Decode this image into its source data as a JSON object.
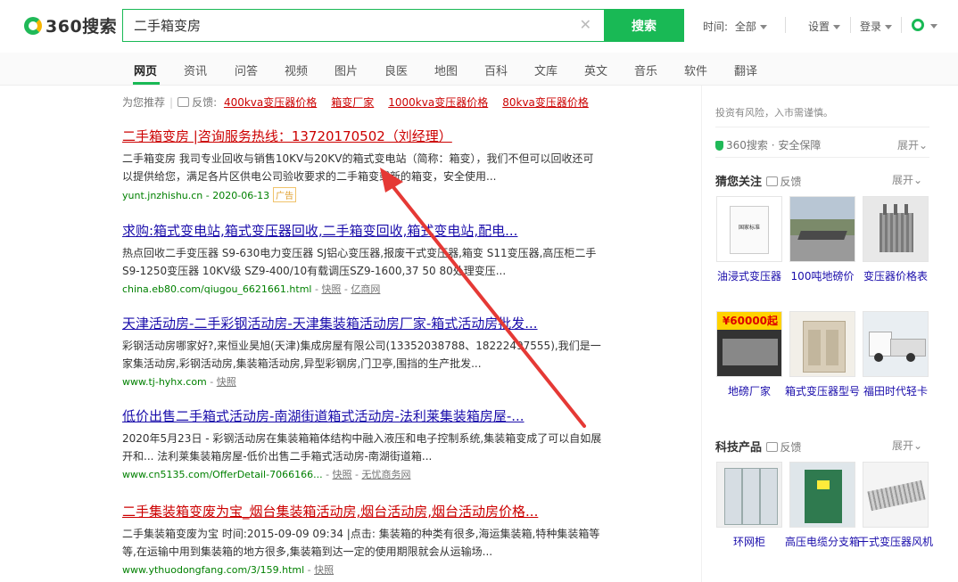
{
  "header": {
    "logo_text": "360搜索",
    "search_value": "二手箱变房",
    "search_button": "搜索",
    "time_label": "时间:",
    "time_value": "全部",
    "settings_label": "设置",
    "login_label": "登录"
  },
  "tabs": [
    "网页",
    "资讯",
    "问答",
    "视频",
    "图片",
    "良医",
    "地图",
    "百科",
    "文库",
    "英文",
    "音乐",
    "软件",
    "翻译"
  ],
  "suggestions": {
    "label": "为您推荐",
    "feedback": "反馈",
    "items": [
      "400kva变压器价格",
      "箱变厂家",
      "1000kva变压器价格",
      "80kva变压器价格"
    ]
  },
  "results": [
    {
      "title": "二手箱变房 |咨询服务热线：13720170502（刘经理）",
      "desc": "二手箱变房 我司专业回收与销售10KV与20KV的箱式变电站（简称：箱变），我们不但可以回收还可以提供给您，满足各片区供电公司验收要求的二手箱变或新的箱变，安全使用...",
      "url": "yunt.jnzhishu.cn - 2020-06-13",
      "ad": "广告"
    },
    {
      "title": "求购:箱式变电站,箱式变压器回收,二手箱变回收,箱式变电站,配电...",
      "desc": "热点回收二手变压器 S9-630电力变压器 SJ铝心变压器,报废干式变压器,箱变 S11变压器,高压柜二手S9-1250变压器 10KV级 SZ9-400/10有载调压SZ9-1600,37 50 80处理变压...",
      "url": "china.eb80.com/qiugou_6621661.html",
      "snap": "快照",
      "source": "亿商网"
    },
    {
      "title": "天津活动房-二手彩钢活动房-天津集装箱活动房厂家-箱式活动房批发...",
      "desc": "彩钢活动房哪家好?,来恒业昊旭(天津)集成房屋有限公司(13352038788、18222497555),我们是一家集活动房,彩钢活动房,集装箱活动房,异型彩钢房,门卫亭,围挡的生产批发...",
      "url": "www.tj-hyhx.com",
      "snap": "快照"
    },
    {
      "title": "低价出售二手箱式活动房-南湖街道箱式活动房-法利莱集装箱房屋-...",
      "desc": "2020年5月23日 - 彩钢活动房在集装箱箱体结构中融入液压和电子控制系统,集装箱变成了可以自如展开和... 法利莱集装箱房屋-低价出售二手箱式活动房-南湖街道箱...",
      "url": "www.cn5135.com/OfferDetail-7066166...",
      "snap": "快照",
      "source": "无忧商务网"
    },
    {
      "title": "二手集装箱变废为宝_烟台集装箱活动房,烟台活动房,烟台活动房价格...",
      "desc": "二手集装箱变废为宝 时间:2015-09-09 09:34 |点击: 集装箱的种类有很多,海运集装箱,特种集装箱等等,在运输中用到集装箱的地方很多,集装箱到达一定的使用期限就会从运输场...",
      "url": "www.ythuodongfang.com/3/159.html",
      "snap": "快照"
    }
  ],
  "right": {
    "risk": "投资有风险，入市需谨慎。",
    "safe": "360搜索 · 安全保障",
    "expand": "展开",
    "sec1_title": "猜您关注",
    "sec2_title": "科技产品",
    "feedback": "反馈",
    "row1": [
      "油浸式变压器",
      "100吨地磅价",
      "变压器价格表"
    ],
    "row2": [
      "地磅厂家",
      "箱式变压器型号",
      "福田时代轻卡"
    ],
    "row3": [
      "环网柜",
      "高压电缆分支箱",
      "干式变压器风机"
    ],
    "thumb_texts": {
      "standard": "国家标准",
      "price": "¥60000",
      "price_suffix": "起"
    }
  },
  "colors": {
    "accent": "#19b955",
    "link": "#1a0dab",
    "highlight": "#c00000",
    "url_green": "#008000",
    "arrow": "#e53935"
  }
}
